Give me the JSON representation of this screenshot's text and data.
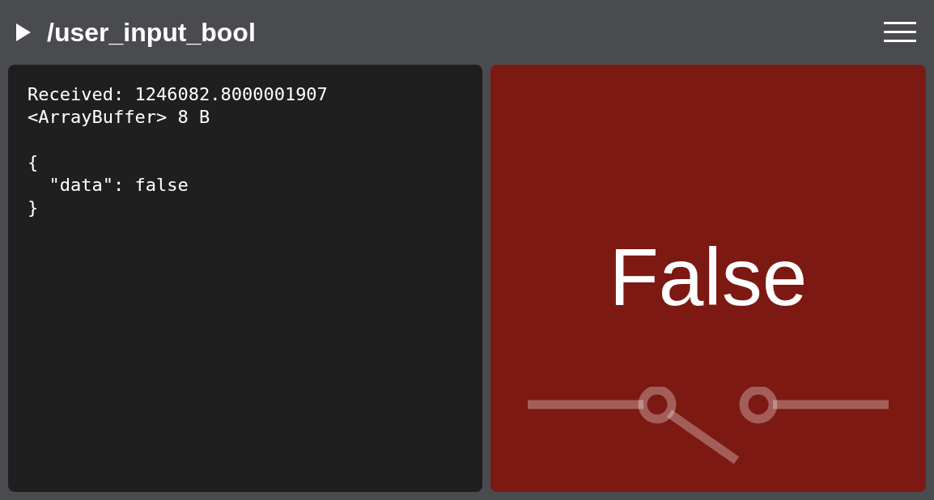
{
  "header": {
    "title": "/user_input_bool"
  },
  "message": {
    "meta": [
      "Received: 1246082.8000001907",
      "<ArrayBuffer> 8 B"
    ],
    "body": "{\n  \"data\": false\n}"
  },
  "display": {
    "label": "False",
    "on": false
  }
}
